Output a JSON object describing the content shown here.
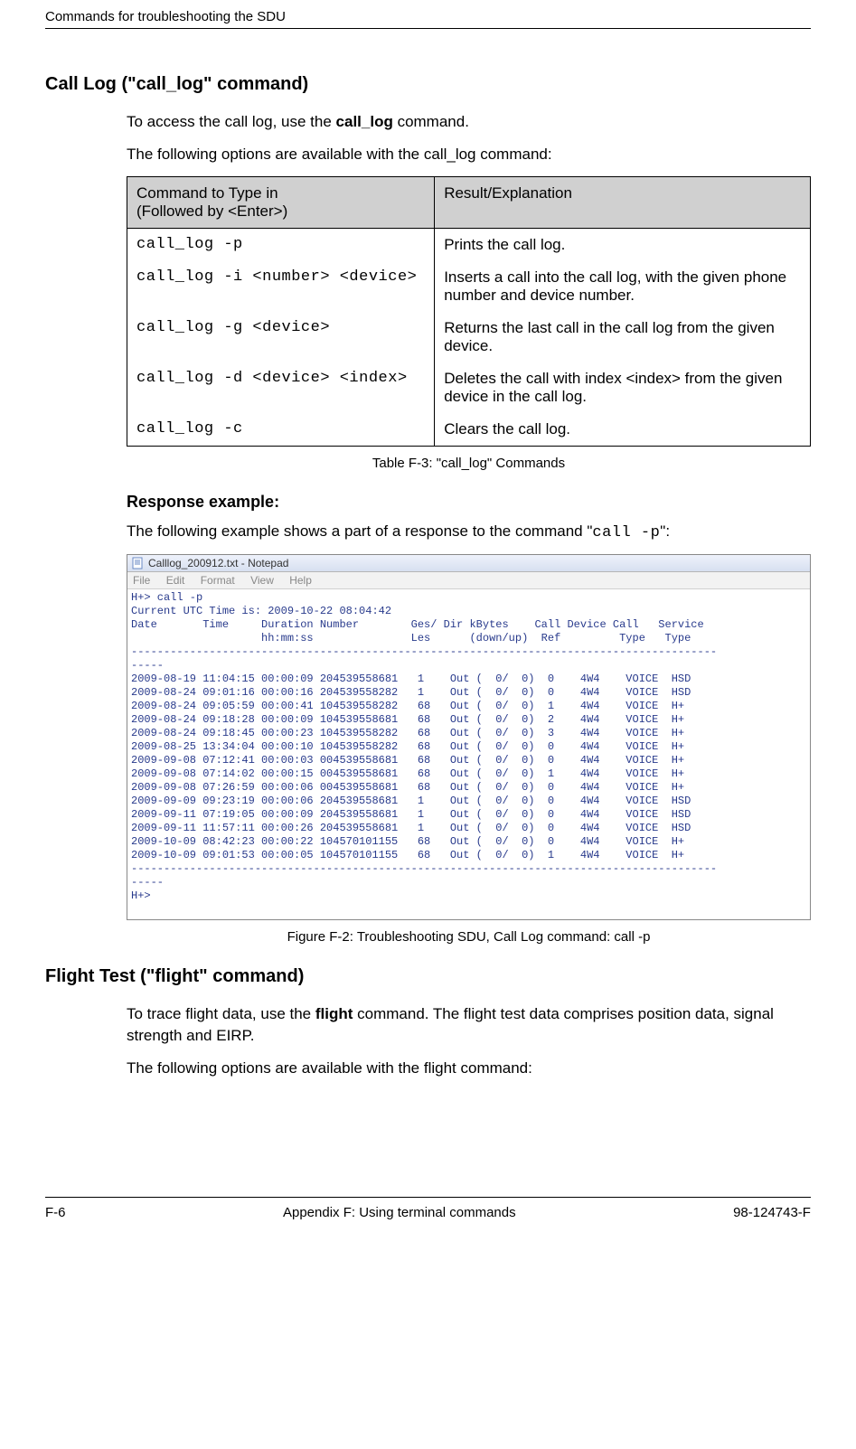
{
  "header": "Commands for troubleshooting the SDU",
  "section1": {
    "title": "Call Log (\"call_log\" command)",
    "p1a": "To access the call log, use the ",
    "p1b": "call_log",
    "p1c": " command.",
    "p2": "The following options are available with the call_log command:"
  },
  "table1": {
    "head1a": "Command to Type in",
    "head1b": "(Followed by <Enter>)",
    "head2": "Result/Explanation",
    "rows": [
      {
        "cmd": "call_log -p",
        "desc": "Prints the call log."
      },
      {
        "cmd": "call_log -i <number> <device>",
        "desc": "Inserts a call into the call log, with the given phone number and device number."
      },
      {
        "cmd": "call_log -g <device>",
        "desc": "Returns the last call in the call log from the given device."
      },
      {
        "cmd": "call_log -d <device> <index>",
        "desc": "Deletes the call with index <index> from the given device in the call log."
      },
      {
        "cmd": "call_log -c",
        "desc": "Clears the call log."
      }
    ],
    "caption": "Table F-3: \"call_log\" Commands"
  },
  "response": {
    "title": "Response example:",
    "p1a": "The following example shows a part of a response to the command \"",
    "p1b": "call -p",
    "p1c": "\":"
  },
  "notepad": {
    "title": "Calllog_200912.txt - Notepad",
    "menu": [
      "File",
      "Edit",
      "Format",
      "View",
      "Help"
    ],
    "body": "H+> call -p\nCurrent UTC Time is: 2009-10-22 08:04:42\nDate       Time     Duration Number        Ges/ Dir kBytes    Call Device Call   Service\n                    hh:mm:ss               Les      (down/up)  Ref         Type   Type\n------------------------------------------------------------------------------------------\n-----\n2009-08-19 11:04:15 00:00:09 204539558681   1    Out (  0/  0)  0    4W4    VOICE  HSD\n2009-08-24 09:01:16 00:00:16 204539558282   1    Out (  0/  0)  0    4W4    VOICE  HSD\n2009-08-24 09:05:59 00:00:41 104539558282   68   Out (  0/  0)  1    4W4    VOICE  H+\n2009-08-24 09:18:28 00:00:09 104539558681   68   Out (  0/  0)  2    4W4    VOICE  H+\n2009-08-24 09:18:45 00:00:23 104539558282   68   Out (  0/  0)  3    4W4    VOICE  H+\n2009-08-25 13:34:04 00:00:10 104539558282   68   Out (  0/  0)  0    4W4    VOICE  H+\n2009-09-08 07:12:41 00:00:03 004539558681   68   Out (  0/  0)  0    4W4    VOICE  H+\n2009-09-08 07:14:02 00:00:15 004539558681   68   Out (  0/  0)  1    4W4    VOICE  H+\n2009-09-08 07:26:59 00:00:06 004539558681   68   Out (  0/  0)  0    4W4    VOICE  H+\n2009-09-09 09:23:19 00:00:06 204539558681   1    Out (  0/  0)  0    4W4    VOICE  HSD\n2009-09-11 07:19:05 00:00:09 204539558681   1    Out (  0/  0)  0    4W4    VOICE  HSD\n2009-09-11 11:57:11 00:00:26 204539558681   1    Out (  0/  0)  0    4W4    VOICE  HSD\n2009-10-09 08:42:23 00:00:22 104570101155   68   Out (  0/  0)  0    4W4    VOICE  H+\n2009-10-09 09:01:53 00:00:05 104570101155   68   Out (  0/  0)  1    4W4    VOICE  H+\n------------------------------------------------------------------------------------------\n-----\nH+>"
  },
  "figcaption": "Figure F-2: Troubleshooting SDU, Call Log command: call -p",
  "section2": {
    "title": "Flight Test (\"flight\" command)",
    "p1a": "To trace flight data, use the ",
    "p1b": "flight",
    "p1c": " command. The flight test data comprises position data, signal strength and EIRP.",
    "p2": "The following options are available with the flight command:"
  },
  "footer": {
    "left": "F-6",
    "center": "Appendix F:  Using terminal commands",
    "right": "98-124743-F"
  }
}
